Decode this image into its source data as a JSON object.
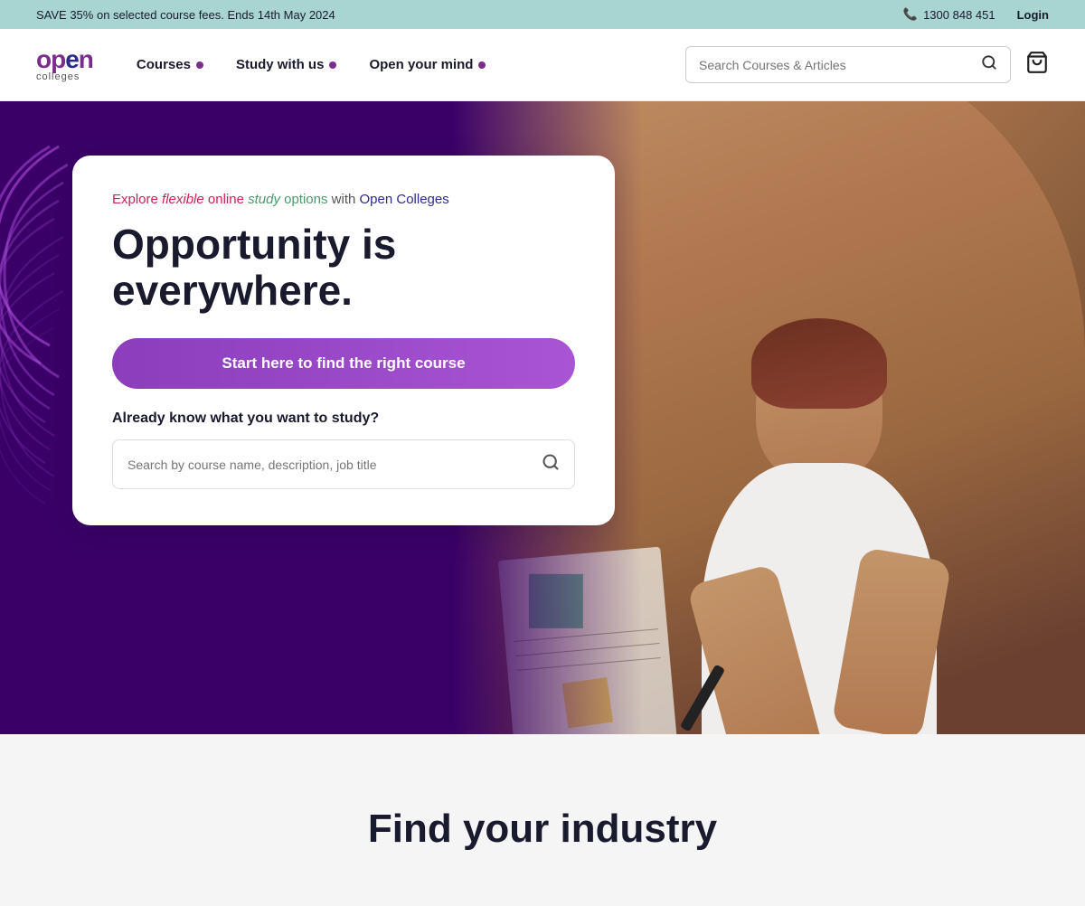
{
  "topBanner": {
    "promoText": "SAVE 35% on selected course fees. Ends 14th May 2024",
    "phone": "1300 848 451",
    "login": "Login"
  },
  "nav": {
    "logo": {
      "open": "open",
      "colleges": "colleges"
    },
    "items": [
      {
        "id": "courses",
        "label": "Courses"
      },
      {
        "id": "study-with-us",
        "label": "Study with us"
      },
      {
        "id": "open-your-mind",
        "label": "Open your mind"
      }
    ],
    "searchPlaceholder": "Search Courses & Articles"
  },
  "hero": {
    "taglineRaw": "Explore flexible online study options with Open Colleges",
    "heading": "Opportunity is everywhere.",
    "ctaButton": "Start here to find the right course",
    "alreadyKnow": "Already know what you want to study?",
    "searchPlaceholder": "Search by course name, description, job title"
  },
  "belowHero": {
    "title": "Find your industry"
  },
  "icons": {
    "search": "🔍",
    "phone": "📞",
    "cart": "🛍"
  }
}
